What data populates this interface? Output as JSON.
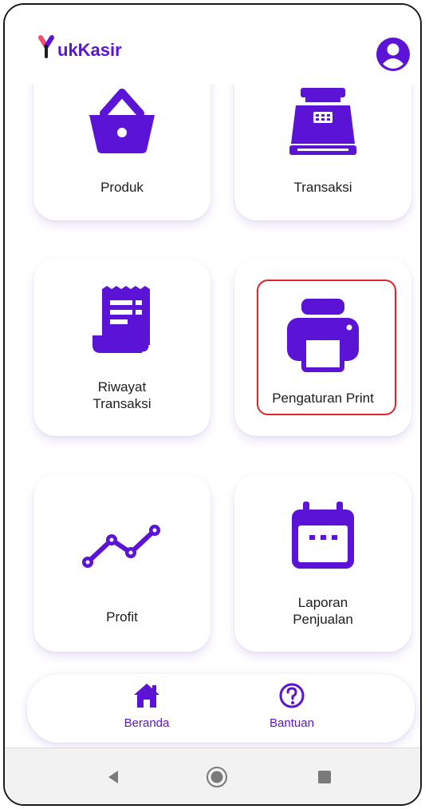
{
  "app": {
    "logo_text": "ukKasir"
  },
  "menu": [
    {
      "label": "Produk",
      "icon": "shopping-basket-icon"
    },
    {
      "label": "Transaksi",
      "icon": "cash-register-icon"
    },
    {
      "label": "Riwayat\nTransaksi",
      "icon": "receipt-icon"
    },
    {
      "label": "Pengaturan Print",
      "icon": "printer-icon",
      "highlighted": true
    },
    {
      "label": "Profit",
      "icon": "line-chart-icon"
    },
    {
      "label": "Laporan\nPenjualan",
      "icon": "calendar-icon"
    }
  ],
  "bottom_nav": [
    {
      "label": "Beranda",
      "icon": "home-icon"
    },
    {
      "label": "Bantuan",
      "icon": "help-icon"
    }
  ],
  "colors": {
    "accent": "#5b13d6",
    "highlight": "#e0242d",
    "logo_red": "#f0506e"
  }
}
